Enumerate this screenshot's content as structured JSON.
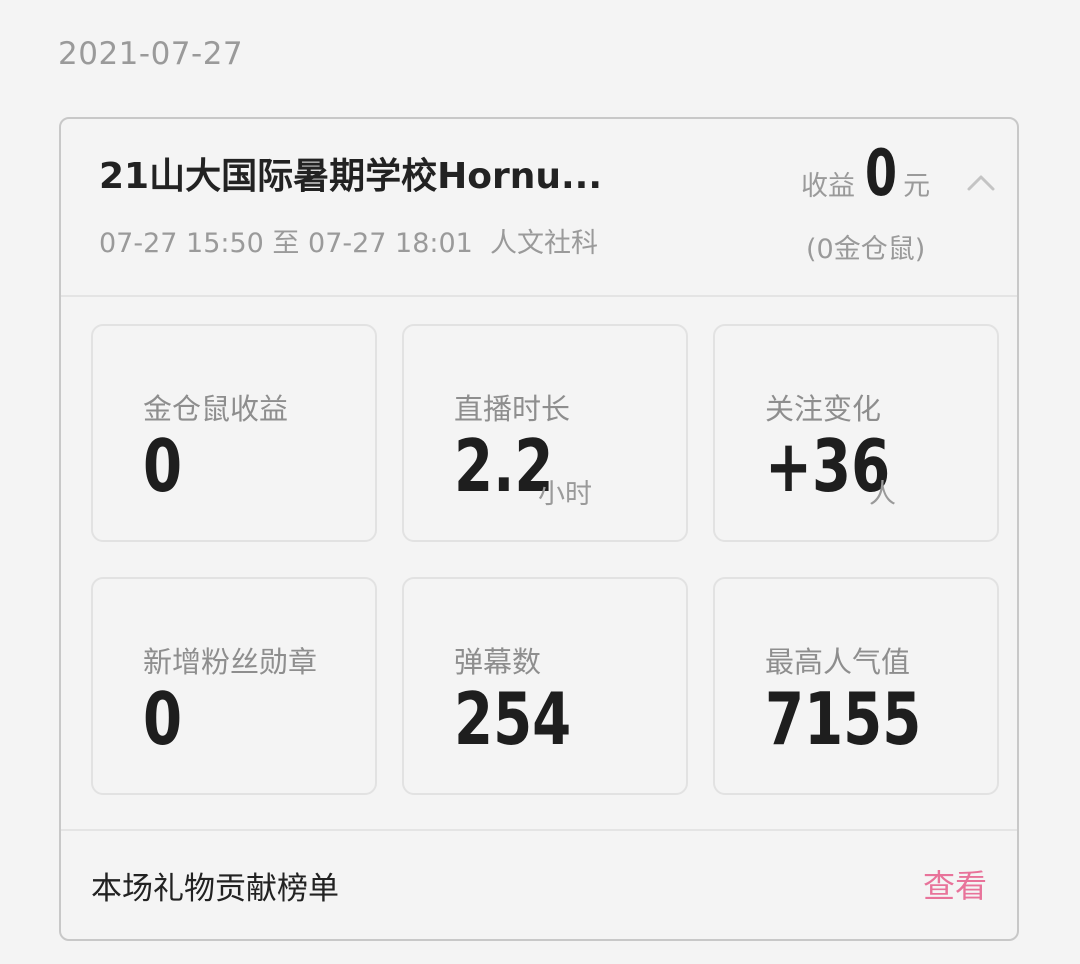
{
  "date": "2021-07-27",
  "session": {
    "title": "21山大国际暑期学校Hornu...",
    "time_range": "07-27 15:50 至 07-27 18:01",
    "category": "人文社科",
    "earnings_label": "收益",
    "earnings_value": "0",
    "earnings_unit": "元",
    "earnings_sub": "(0金仓鼠)",
    "collapse_icon": "chevron-up-icon"
  },
  "stats": [
    {
      "label": "金仓鼠收益",
      "value": "0",
      "unit": ""
    },
    {
      "label": "直播时长",
      "value": "2.2",
      "unit": "小时"
    },
    {
      "label": "关注变化",
      "value": "+36",
      "unit": "人"
    },
    {
      "label": "新增粉丝勋章",
      "value": "0",
      "unit": ""
    },
    {
      "label": "弹幕数",
      "value": "254",
      "unit": ""
    },
    {
      "label": "最高人气值",
      "value": "7155",
      "unit": ""
    }
  ],
  "footer": {
    "label": "本场礼物贡献榜单",
    "link": "查看"
  },
  "colors": {
    "accent_link": "#e8739a",
    "background": "#f4f4f4"
  }
}
